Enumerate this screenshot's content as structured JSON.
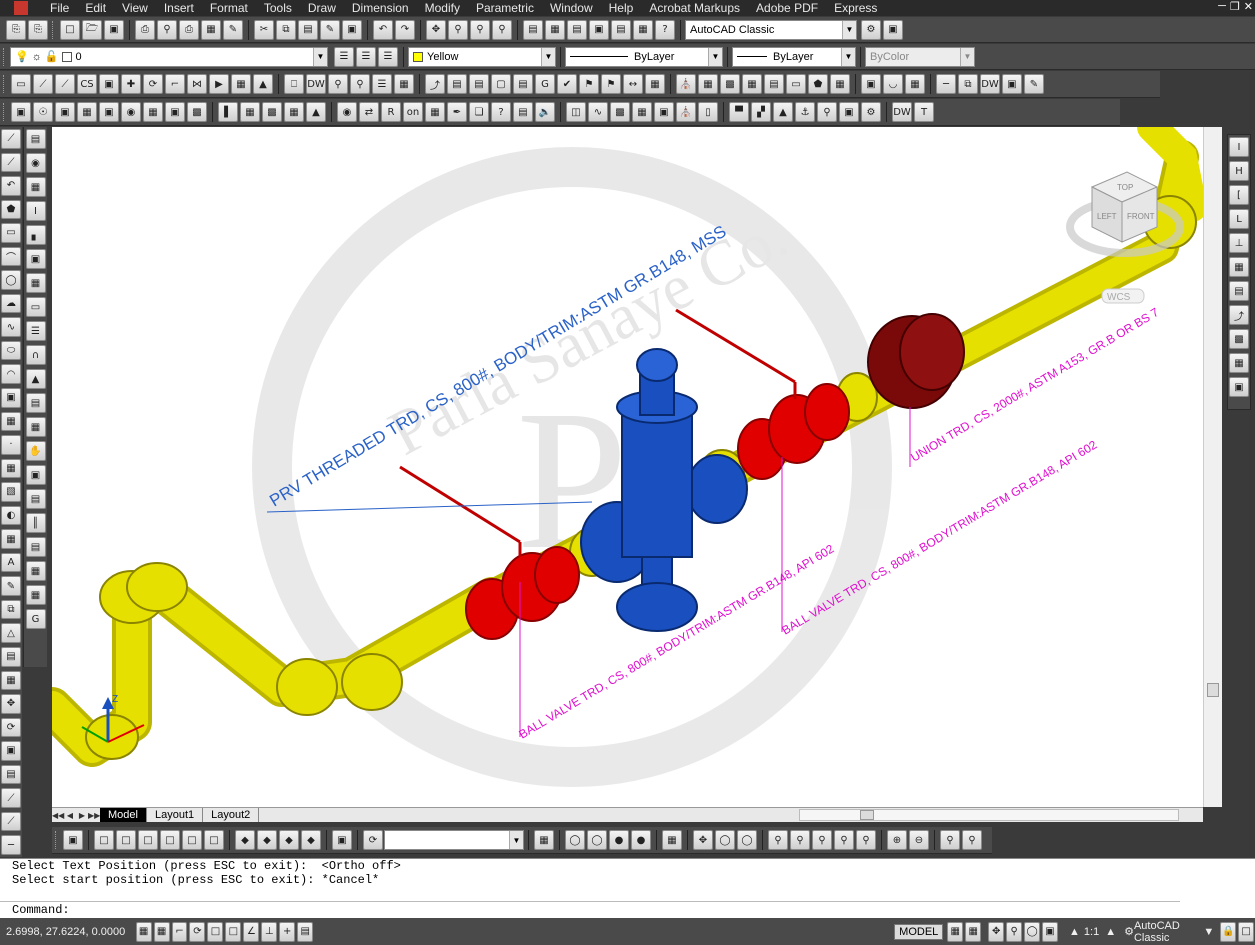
{
  "menubar": {
    "items": [
      "File",
      "Edit",
      "View",
      "Insert",
      "Format",
      "Tools",
      "Draw",
      "Dimension",
      "Modify",
      "Parametric",
      "Window",
      "Help",
      "Acrobat Markups",
      "Adobe PDF",
      "Express"
    ]
  },
  "toolbar1": {
    "workspace": "AutoCAD Classic"
  },
  "toolbar2": {
    "layer": "0",
    "color": "Yellow",
    "linetype": "ByLayer",
    "lineweight": "ByLayer",
    "plotstyle": "ByColor"
  },
  "viewcube": {
    "top": "TOP",
    "left": "LEFT",
    "front": "FRONT",
    "wcs": "WCS"
  },
  "canvas": {
    "watermark": "Parla Sanaye Co.",
    "labels": {
      "prv": "PRV THREADED TRD, CS, 800#, BODY/TRIM:ASTM GR.B148, MSS",
      "union": "UNION TRD, CS, 2000#, ASTM A153, GR.B OR BS 7",
      "ball1": "BALL VALVE TRD, CS, 800#, BODY/TRIM:ASTM GR.B148, API 602",
      "ball2": "BALL VALVE TRD, CS, 800#, BODY/TRIM:ASTM GR.B148, API 602"
    }
  },
  "tabs": [
    "Model",
    "Layout1",
    "Layout2"
  ],
  "command": {
    "lines": [
      "Select Text Position (press ESC to exit):  <Ortho off>",
      "Select start position (press ESC to exit): *Cancel*"
    ],
    "prompt": "Command:"
  },
  "status": {
    "coords": "2.6998, 27.6224, 0.0000",
    "model": "MODEL",
    "scale": "1:1",
    "workspace": "AutoCAD Classic"
  },
  "colors": {
    "pipe": "#e6e000",
    "valve": "#e00000",
    "prv": "#1a4fc0",
    "union": "#7a0a0a",
    "label_blue": "#2a62c8",
    "label_magenta": "#e010d0"
  }
}
